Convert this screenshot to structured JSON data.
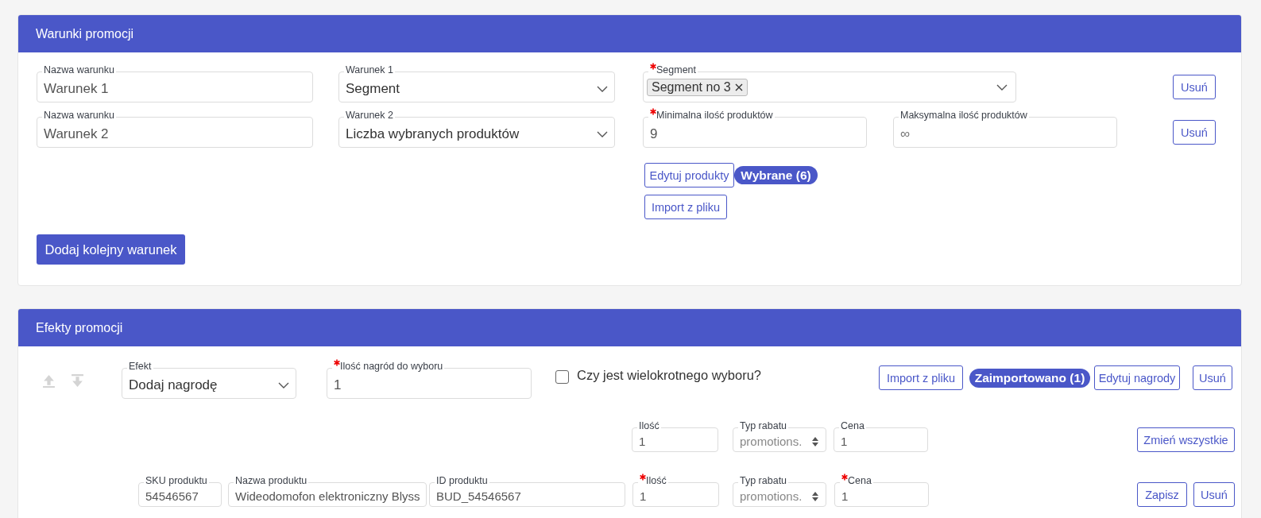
{
  "conditions_panel": {
    "title": "Warunki promocji",
    "conditions": [
      {
        "name_field": {
          "kind": "text",
          "label": "Nazwa warunku",
          "required": false,
          "value": "Warunek 1"
        },
        "type_select": {
          "kind": "select",
          "label": "Warunek 1",
          "required": false,
          "value": "Segment"
        },
        "params": [
          {
            "kind": "tags",
            "label": "Segment",
            "required": true,
            "tags": [
              "Segment no 3"
            ]
          }
        ],
        "remove_button": "Usuń"
      },
      {
        "name_field": {
          "kind": "text",
          "label": "Nazwa warunku",
          "required": false,
          "value": "Warunek 2"
        },
        "type_select": {
          "kind": "select",
          "label": "Warunek 2",
          "required": false,
          "value": "Liczba wybranych produktów"
        },
        "params": [
          {
            "kind": "text",
            "label": "Minimalna ilość produktów",
            "required": true,
            "value": "9"
          },
          {
            "kind": "text",
            "label": "Maksymalna ilość produktów",
            "required": false,
            "placeholder": "∞"
          }
        ],
        "remove_button": "Usuń",
        "product_actions": {
          "edit_button": "Edytuj produkty",
          "selected_badge": "Wybrane (6)",
          "import_button": "Import z pliku"
        }
      }
    ],
    "add_button": "Dodaj kolejny warunek"
  },
  "effects_panel": {
    "title": "Efekty promocji",
    "effect": {
      "effect_select": {
        "kind": "select",
        "label": "Efekt",
        "required": false,
        "value": "Dodaj nagrodę"
      },
      "reward_count": {
        "kind": "text",
        "label": "Ilość nagród do wyboru",
        "required": true,
        "value": "1"
      },
      "multiple_choice": {
        "label": "Czy jest wielokrotnego wyboru?",
        "checked": false
      },
      "import_button": "Import z pliku",
      "imported_badge": "Zaimportowano (1)",
      "edit_button": "Edytuj nagrody",
      "remove_button": "Usuń",
      "bulk_row": {
        "fields": [
          {
            "kind": "text",
            "label": "Ilość",
            "required": false,
            "value": "1"
          },
          {
            "kind": "spinner",
            "label": "Typ rabatu",
            "required": false,
            "value": "promotions."
          },
          {
            "kind": "text",
            "label": "Cena",
            "required": false,
            "value": "1"
          }
        ],
        "apply_button": "Zmień wszystkie"
      },
      "products": [
        {
          "fields": [
            {
              "kind": "text",
              "label": "SKU produktu",
              "required": false,
              "value": "54546567"
            },
            {
              "kind": "text",
              "label": "Nazwa produktu",
              "required": false,
              "value": "Wideodomofon elektroniczny Blyss"
            },
            {
              "kind": "text",
              "label": "ID produktu",
              "required": false,
              "value": "BUD_54546567"
            },
            {
              "kind": "text",
              "label": "Ilość",
              "required": true,
              "value": "1"
            },
            {
              "kind": "spinner",
              "label": "Typ rabatu",
              "required": false,
              "value": "promotions."
            },
            {
              "kind": "text",
              "label": "Cena",
              "required": true,
              "value": "1"
            }
          ],
          "save_button": "Zapisz",
          "remove_button": "Usuń"
        }
      ]
    }
  }
}
